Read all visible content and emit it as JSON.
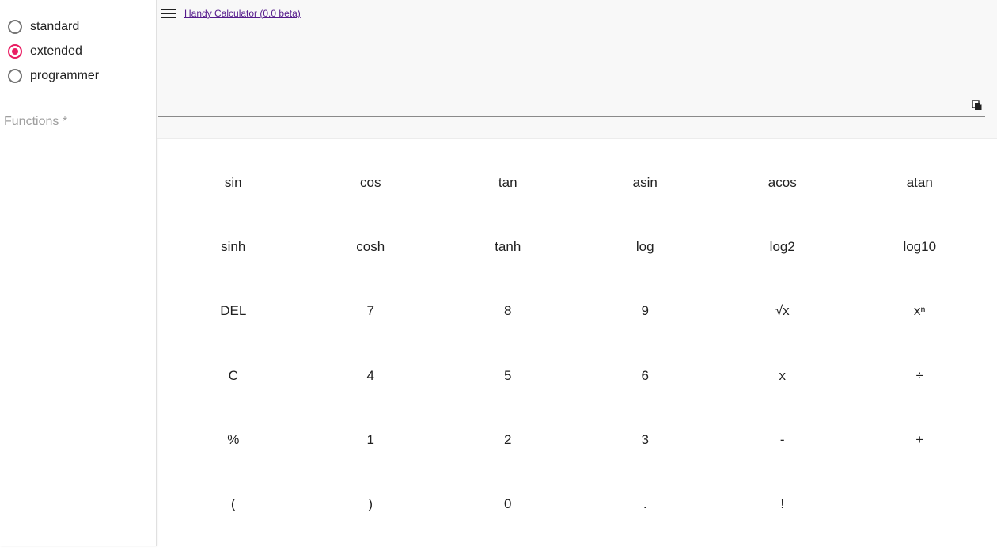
{
  "sidebar": {
    "modes": [
      {
        "label": "standard",
        "checked": false
      },
      {
        "label": "extended",
        "checked": true
      },
      {
        "label": "programmer",
        "checked": false
      }
    ],
    "functions_placeholder": "Functions *"
  },
  "header": {
    "title": " Handy Calculator (0.0 beta)",
    "menu_icon": "hamburger-menu-icon",
    "copy_icon": "copy-icon",
    "display_value": ""
  },
  "keypad": {
    "rows": [
      [
        "sin",
        "cos",
        "tan",
        "asin",
        "acos",
        "atan"
      ],
      [
        "sinh",
        "cosh",
        "tanh",
        "log",
        "log2",
        "log10"
      ],
      [
        "DEL",
        "7",
        "8",
        "9",
        "√x",
        "xⁿ"
      ],
      [
        "C",
        "4",
        "5",
        "6",
        "x",
        "÷"
      ],
      [
        "%",
        "1",
        "2",
        "3",
        "-",
        "+"
      ],
      [
        "(",
        ")",
        "0",
        ".",
        "!",
        ""
      ]
    ]
  },
  "colors": {
    "accent": "#e91e63",
    "header_bg": "#f8f8f8",
    "link": "#551a8b"
  }
}
